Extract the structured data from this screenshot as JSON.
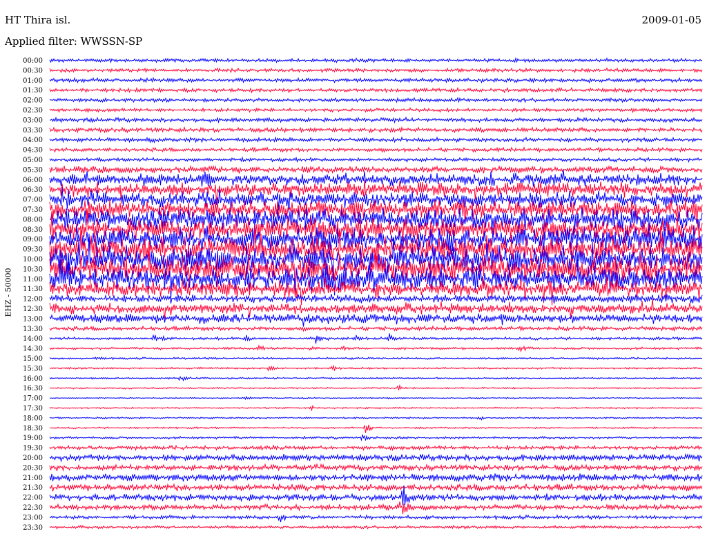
{
  "header": {
    "station": "HT Thira isl.",
    "date": "2009-01-05",
    "filter": "Applied filter: WWSSN-SP",
    "channel": "EHZ - 50000"
  },
  "colors": {
    "even": "#0000ff",
    "odd": "#ff0033",
    "background": "#ffffff"
  },
  "chart_data": {
    "type": "line",
    "title": "HT Thira isl.",
    "subtitle": "Applied filter: WWSSN-SP",
    "ylabel": "EHZ - 50000",
    "x_unit": "minutes within half-hour line",
    "xlim": [
      0,
      30
    ],
    "ytick_labels": [
      "00:00",
      "00:30",
      "01:00",
      "01:30",
      "02:00",
      "02:30",
      "03:00",
      "03:30",
      "04:00",
      "04:30",
      "05:00",
      "05:30",
      "06:00",
      "06:30",
      "07:00",
      "07:30",
      "08:00",
      "08:30",
      "09:00",
      "09:30",
      "10:00",
      "10:30",
      "11:00",
      "11:30",
      "12:00",
      "12:30",
      "13:00",
      "13:30",
      "14:00",
      "14:30",
      "15:00",
      "15:30",
      "16:00",
      "16:30",
      "17:00",
      "17:30",
      "18:00",
      "18:30",
      "19:00",
      "19:30",
      "20:00",
      "20:30",
      "21:00",
      "21:30",
      "22:00",
      "22:30",
      "23:00",
      "23:30"
    ],
    "noise_level": [
      2.2,
      2.2,
      2.4,
      2.4,
      2.3,
      2.2,
      2.5,
      2.8,
      2.5,
      2.4,
      2.2,
      4.0,
      7.0,
      8.5,
      9.5,
      11.0,
      12.5,
      13.5,
      14.0,
      14.0,
      15.0,
      15.5,
      14.5,
      10.0,
      5.0,
      6.0,
      5.5,
      2.5,
      1.6,
      1.4,
      1.2,
      1.1,
      1.0,
      0.9,
      0.8,
      0.9,
      1.0,
      1.0,
      1.4,
      2.5,
      3.8,
      3.5,
      4.5,
      4.0,
      4.0,
      3.2,
      2.2,
      1.8
    ],
    "events": [
      {
        "line": 3,
        "minute": 7.2,
        "amp": 2.5
      },
      {
        "line": 8,
        "minute": 4.5,
        "amp": 2
      },
      {
        "line": 11,
        "minute": 7.0,
        "amp": 4
      },
      {
        "line": 12,
        "minute": 7.0,
        "amp": 5
      },
      {
        "line": 28,
        "minute": 4.8,
        "amp": 8
      },
      {
        "line": 28,
        "minute": 9.0,
        "amp": 6
      },
      {
        "line": 28,
        "minute": 12.2,
        "amp": 8
      },
      {
        "line": 28,
        "minute": 14.0,
        "amp": 5
      },
      {
        "line": 28,
        "minute": 15.6,
        "amp": 7
      },
      {
        "line": 29,
        "minute": 9.6,
        "amp": 5
      },
      {
        "line": 29,
        "minute": 12.0,
        "amp": 4
      },
      {
        "line": 29,
        "minute": 13.4,
        "amp": 3
      },
      {
        "line": 29,
        "minute": 21.6,
        "amp": 6
      },
      {
        "line": 30,
        "minute": 2.1,
        "amp": 4
      },
      {
        "line": 31,
        "minute": 10.0,
        "amp": 6
      },
      {
        "line": 31,
        "minute": 13.0,
        "amp": 5
      },
      {
        "line": 32,
        "minute": 6.0,
        "amp": 6
      },
      {
        "line": 33,
        "minute": 16.0,
        "amp": 5
      },
      {
        "line": 34,
        "minute": 9.0,
        "amp": 3
      },
      {
        "line": 35,
        "minute": 12.0,
        "amp": 4
      },
      {
        "line": 36,
        "minute": 19.7,
        "amp": 5
      },
      {
        "line": 37,
        "minute": 14.5,
        "amp": 10
      },
      {
        "line": 38,
        "minute": 14.3,
        "amp": 7
      },
      {
        "line": 44,
        "minute": 16.2,
        "amp": 18
      },
      {
        "line": 45,
        "minute": 16.1,
        "amp": 14
      },
      {
        "line": 46,
        "minute": 10.5,
        "amp": 10
      }
    ]
  }
}
